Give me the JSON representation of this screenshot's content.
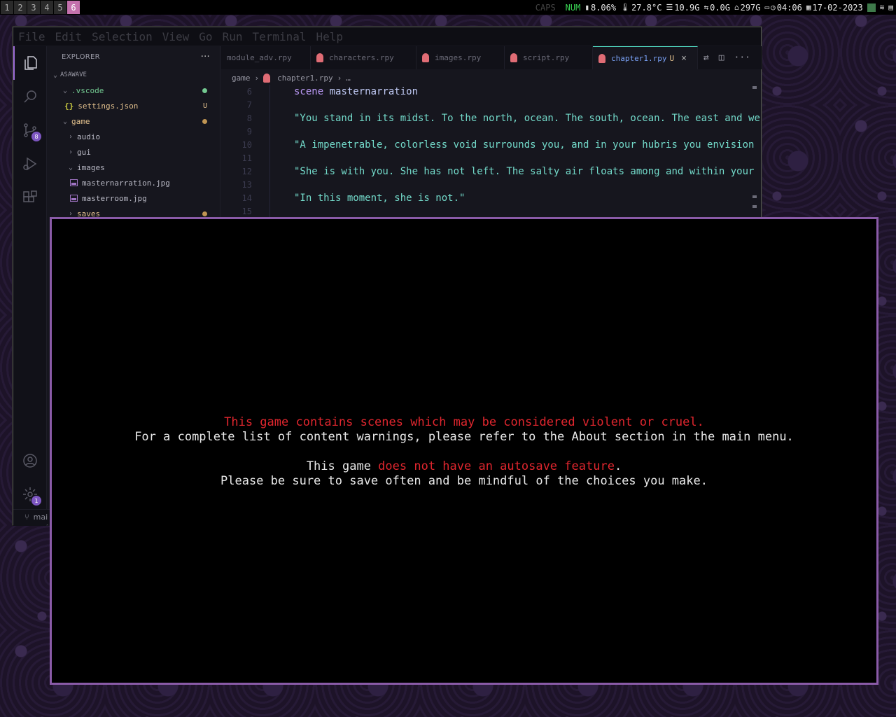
{
  "statusbar": {
    "workspaces": [
      "1",
      "2",
      "3",
      "4",
      "5",
      "6"
    ],
    "active_workspace": "6",
    "caps": "CAPS",
    "num": "NUM",
    "cpu": "8.06%",
    "temp": "27.8°C",
    "memory": "10.9G",
    "swap": "0.0G",
    "disk": "297G",
    "time": "04:06",
    "date": "17-02-2023"
  },
  "vscode": {
    "menu": [
      "File",
      "Edit",
      "Selection",
      "View",
      "Go",
      "Run",
      "Terminal",
      "Help"
    ],
    "explorer_title": "EXPLORER",
    "explorer_more": "···",
    "root": "ASAWAVE",
    "tree": {
      "vscode_folder": ".vscode",
      "settings_file": "settings.json",
      "settings_status": "U",
      "game_folder": "game",
      "audio": "audio",
      "gui": "gui",
      "images": "images",
      "file1": "masternarration.jpg",
      "file2": "masterroom.jpg",
      "saves": "saves"
    },
    "source_control_badge": "8",
    "settings_badge": "1",
    "branch": "mai",
    "tabs": [
      {
        "label": "module_adv.rpy"
      },
      {
        "label": "characters.rpy"
      },
      {
        "label": "images.rpy"
      },
      {
        "label": "script.rpy"
      },
      {
        "label": "chapter1.rpy",
        "status": "U"
      }
    ],
    "tab_close": "×",
    "breadcrumb": {
      "folder": "game",
      "file": "chapter1.rpy",
      "more": "…"
    },
    "code": [
      {
        "n": "6",
        "kw": "scene",
        "id": "masternarration",
        "str": ""
      },
      {
        "n": "7",
        "kw": "",
        "id": "",
        "str": ""
      },
      {
        "n": "8",
        "kw": "",
        "id": "",
        "str": "\"You stand in its midst. To the north, ocean. The south, ocean. The east and we"
      },
      {
        "n": "9",
        "kw": "",
        "id": "",
        "str": ""
      },
      {
        "n": "10",
        "kw": "",
        "id": "",
        "str": "\"A impenetrable, colorless void surrounds you, and in your hubris you envision"
      },
      {
        "n": "11",
        "kw": "",
        "id": "",
        "str": ""
      },
      {
        "n": "12",
        "kw": "",
        "id": "",
        "str": "\"She is with you. She has not left. The salty air floats among and within your"
      },
      {
        "n": "13",
        "kw": "",
        "id": "",
        "str": ""
      },
      {
        "n": "14",
        "kw": "",
        "id": "",
        "str": "\"In this moment, she is not.\""
      },
      {
        "n": "15",
        "kw": "",
        "id": "",
        "str": ""
      }
    ]
  },
  "game": {
    "warning_line1": "This game contains scenes which may be considered violent or cruel.",
    "warning_line2": "For a complete list of content warnings, please refer to the About section in the main menu.",
    "autosave_prefix": "This game ",
    "autosave_red": "does not have an autosave feature",
    "autosave_suffix": ".",
    "warning_line4": "Please be sure to save often and be mindful of the choices you make."
  },
  "colors": {
    "accent": "#c471ad",
    "game_border": "#8a5ba8",
    "warning_red": "#e0262e"
  }
}
